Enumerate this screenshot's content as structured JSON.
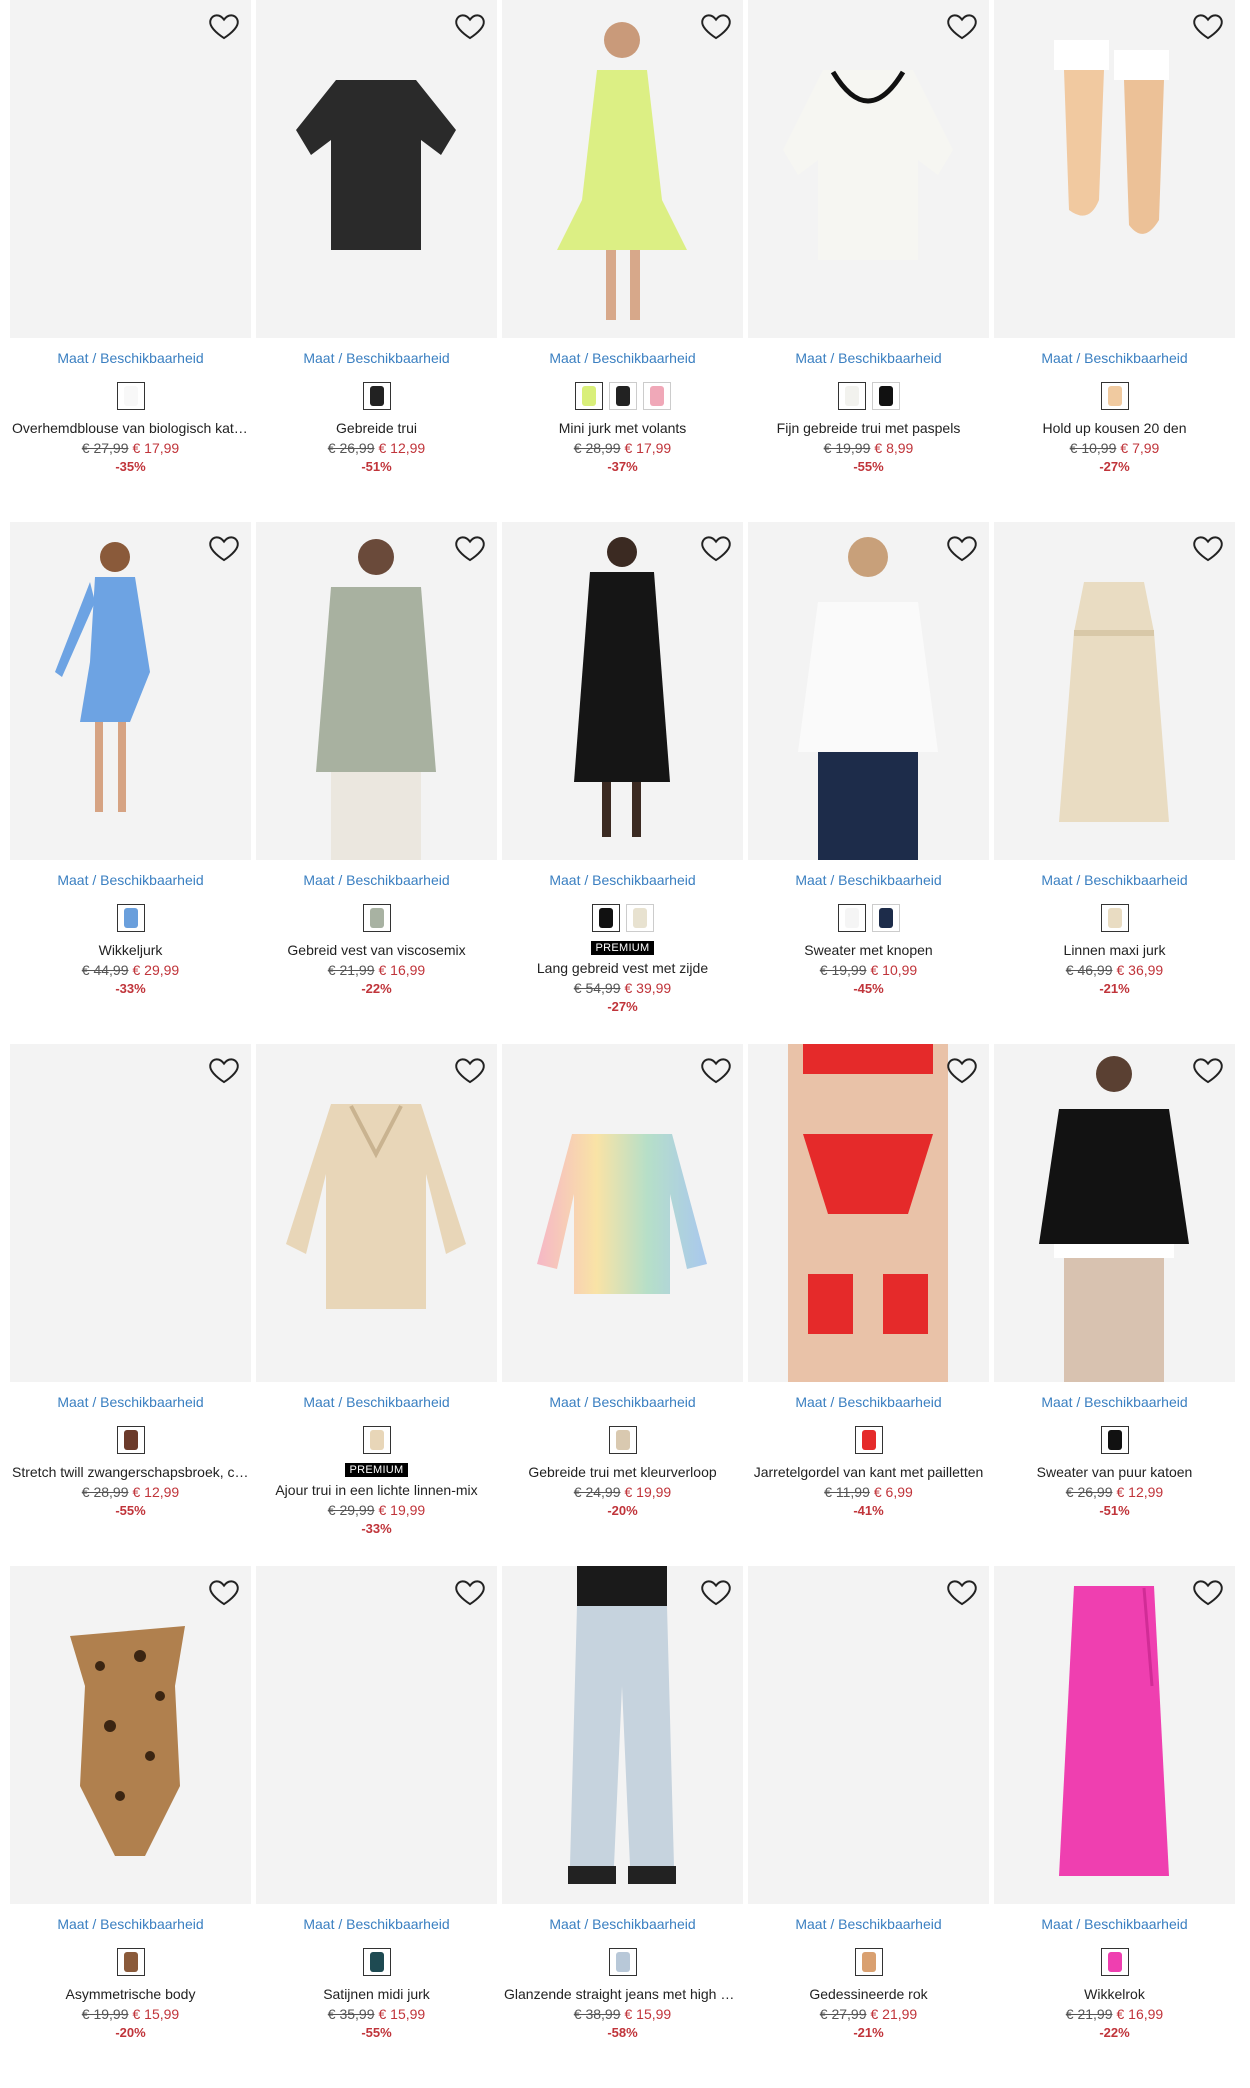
{
  "avail_label": "Maat / Beschikbaarheid",
  "premium_label": "PREMIUM",
  "products": [
    {
      "name": "Overhemdblouse van biologisch katoen",
      "old": "€ 27,99",
      "new": "€ 17,99",
      "disc": "-35%",
      "img": "blank",
      "colors": [
        "#f8f8f8"
      ],
      "premium": false
    },
    {
      "name": "Gebreide trui",
      "old": "€ 26,99",
      "new": "€ 12,99",
      "disc": "-51%",
      "img": "sweater-dark",
      "colors": [
        "#222222"
      ],
      "premium": false
    },
    {
      "name": "Mini jurk met volants",
      "old": "€ 28,99",
      "new": "€ 17,99",
      "disc": "-37%",
      "img": "dress-lime",
      "colors": [
        "#d9ef7a",
        "#222222",
        "#f0a8b8"
      ],
      "premium": false
    },
    {
      "name": "Fijn gebreide trui met paspels",
      "old": "€ 19,99",
      "new": "€ 8,99",
      "disc": "-55%",
      "img": "sweater-white-trim",
      "colors": [
        "#f2f2ee",
        "#111111"
      ],
      "premium": false
    },
    {
      "name": "Hold up kousen 20 den",
      "old": "€ 10,99",
      "new": "€ 7,99",
      "disc": "-27%",
      "img": "stockings",
      "colors": [
        "#f0caa0"
      ],
      "premium": false
    },
    {
      "name": "Wikkeljurk",
      "old": "€ 44,99",
      "new": "€ 29,99",
      "disc": "-33%",
      "img": "dress-blue",
      "colors": [
        "#6a9fdc"
      ],
      "premium": false
    },
    {
      "name": "Gebreid vest van viscosemix",
      "old": "€ 21,99",
      "new": "€ 16,99",
      "disc": "-22%",
      "img": "cardigan-sage",
      "colors": [
        "#a8b2a2"
      ],
      "premium": false
    },
    {
      "name": "Lang gebreid vest met zijde",
      "old": "€ 54,99",
      "new": "€ 39,99",
      "disc": "-27%",
      "img": "cardigan-black",
      "colors": [
        "#111111",
        "#e8e2d0"
      ],
      "premium": true
    },
    {
      "name": "Sweater met knopen",
      "old": "€ 19,99",
      "new": "€ 10,99",
      "disc": "-45%",
      "img": "sweater-white",
      "colors": [
        "#f5f5f5",
        "#1d2c4a"
      ],
      "premium": false
    },
    {
      "name": "Linnen maxi jurk",
      "old": "€ 46,99",
      "new": "€ 36,99",
      "disc": "-21%",
      "img": "dress-beige",
      "colors": [
        "#e9dcc2"
      ],
      "premium": false
    },
    {
      "name": "Stretch twill zwangerschapsbroek, cropped",
      "old": "€ 28,99",
      "new": "€ 12,99",
      "disc": "-55%",
      "img": "blank",
      "colors": [
        "#6b3a2a"
      ],
      "premium": false
    },
    {
      "name": "Ajour trui in een lichte linnen-mix",
      "old": "€ 29,99",
      "new": "€ 19,99",
      "disc": "-33%",
      "img": "sweater-beige",
      "colors": [
        "#e8d6b8"
      ],
      "premium": true
    },
    {
      "name": "Gebreide trui met kleurverloop",
      "old": "€ 24,99",
      "new": "€ 19,99",
      "disc": "-20%",
      "img": "sweater-rainbow",
      "colors": [
        "#d9c9b0"
      ],
      "premium": false
    },
    {
      "name": "Jarretelgordel van kant met pailletten",
      "old": "€ 11,99",
      "new": "€ 6,99",
      "disc": "-41%",
      "img": "lingerie-red",
      "colors": [
        "#e52a2a"
      ],
      "premium": false
    },
    {
      "name": "Sweater van puur katoen",
      "old": "€ 26,99",
      "new": "€ 12,99",
      "disc": "-51%",
      "img": "sweater-black",
      "colors": [
        "#111111"
      ],
      "premium": false
    },
    {
      "name": "Asymmetrische body",
      "old": "€ 19,99",
      "new": "€ 15,99",
      "disc": "-20%",
      "img": "body-leopard",
      "colors": [
        "#8a5a3a"
      ],
      "premium": false
    },
    {
      "name": "Satijnen midi jurk",
      "old": "€ 35,99",
      "new": "€ 15,99",
      "disc": "-55%",
      "img": "blank",
      "colors": [
        "#1e4a52"
      ],
      "premium": false
    },
    {
      "name": "Glanzende straight jeans met high waist",
      "old": "€ 38,99",
      "new": "€ 15,99",
      "disc": "-58%",
      "img": "jeans-silver",
      "colors": [
        "#b8c8d8"
      ],
      "premium": false
    },
    {
      "name": "Gedessineerde rok",
      "old": "€ 27,99",
      "new": "€ 21,99",
      "disc": "-21%",
      "img": "blank",
      "colors": [
        "#d9a070"
      ],
      "premium": false
    },
    {
      "name": "Wikkelrok",
      "old": "€ 21,99",
      "new": "€ 16,99",
      "disc": "-22%",
      "img": "skirt-pink",
      "colors": [
        "#ef3fb0"
      ],
      "premium": false
    }
  ]
}
